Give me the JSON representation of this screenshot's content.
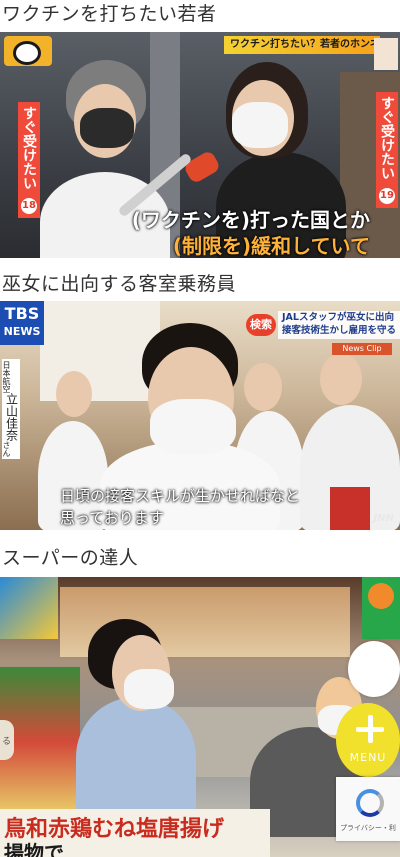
{
  "articles": [
    {
      "heading": "ワクチンを打ちたい若者",
      "overlay": {
        "top_band": "ワクチン打ちたい？若者のホンネ",
        "left_caption": "すぐ受けたい",
        "left_age": "18",
        "right_caption": "すぐ受けたい",
        "right_age": "19",
        "subtitle_1": "(ワクチンを)打った国とか",
        "subtitle_2": "(制限を)緩和していて"
      }
    },
    {
      "heading": "巫女に出向する客室乗務員",
      "overlay": {
        "logo_top": "TBS",
        "logo_bottom": "NEWS",
        "name_org": "日本航空",
        "name": "立山佳奈",
        "name_suffix": "さん",
        "tag": "検索",
        "tag_line_1": "JALスタッフが巫女に出向",
        "tag_line_2": "接客技術生かし雇用を守る",
        "clip": "News Clip",
        "subtitle_1": "日頃の接客スキルが生かせればなと",
        "subtitle_2": "思っております",
        "watermark": "JNN"
      }
    },
    {
      "heading": "スーパーの達人",
      "overlay": {
        "band_line_1": "鳥和赤鶏むね塩唐揚げ",
        "band_line_2": "揚物で"
      }
    }
  ],
  "floating": {
    "menu_label": "MENU",
    "recaptcha_text": "プライバシー・利",
    "edge_label": "る"
  }
}
